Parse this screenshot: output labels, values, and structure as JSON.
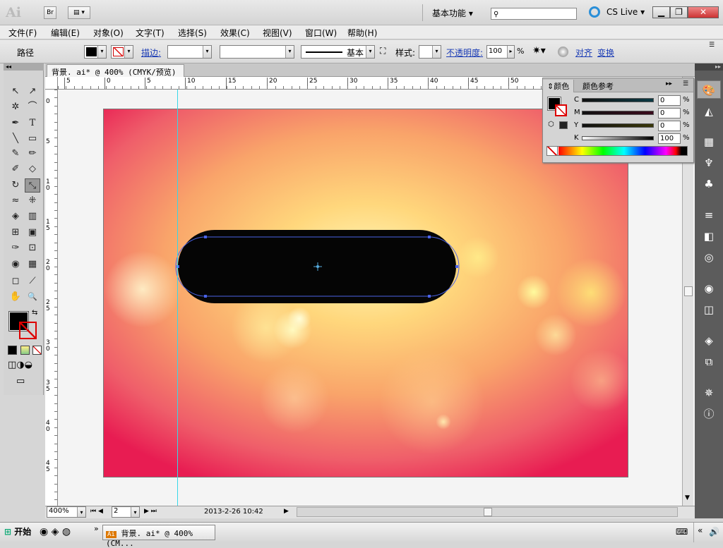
{
  "app": {
    "logo": "Ai",
    "bridge": "Br",
    "workspace": "基本功能",
    "cs_live": "CS Live",
    "window_buttons": [
      "▁",
      "❐",
      "✕"
    ]
  },
  "menu": [
    "文件(F)",
    "编辑(E)",
    "对象(O)",
    "文字(T)",
    "选择(S)",
    "效果(C)",
    "视图(V)",
    "窗口(W)",
    "帮助(H)"
  ],
  "control": {
    "selection_type": "路径",
    "stroke_label": "描边:",
    "stroke_style": "基本",
    "style_label": "样式:",
    "opacity_label": "不透明度:",
    "opacity_value": "100",
    "opacity_unit": "%",
    "align": "对齐",
    "transform": "变换"
  },
  "doc_tab": {
    "title": "背景. ai* @ 400% (CMYK/预览)",
    "close": "✕"
  },
  "ruler": {
    "h_ticks": [
      "5",
      "0",
      "5",
      "10",
      "15",
      "20",
      "25",
      "30",
      "35",
      "40",
      "45",
      "50"
    ],
    "v_ticks": [
      "0",
      "5",
      "1 0",
      "1 5",
      "2 0",
      "2 5",
      "3 0",
      "3 5",
      "4 0",
      "4 5"
    ]
  },
  "status": {
    "zoom": "400%",
    "artboard_nav": "2",
    "info": "2013-2-26  10:42"
  },
  "color_panel": {
    "tab1": "颜色",
    "tab2": "颜色参考",
    "channels": [
      {
        "name": "C",
        "value": "0",
        "unit": "%"
      },
      {
        "name": "M",
        "value": "0",
        "unit": "%"
      },
      {
        "name": "Y",
        "value": "0",
        "unit": "%"
      },
      {
        "name": "K",
        "value": "100",
        "unit": "%"
      }
    ]
  },
  "tools": [
    "↖",
    "↗",
    "✲",
    "⌒",
    "✒",
    "T",
    "╲",
    "▭",
    "✎",
    "✏",
    "✐",
    "◇",
    "↻",
    "⤡",
    "≈",
    "⁜",
    "◈",
    "▥",
    "⊞",
    "▣",
    "✑",
    "⊡",
    "◉",
    "▦",
    "◻",
    "⟋",
    "✋",
    "🔍"
  ],
  "taskbar": {
    "start": "开始",
    "window": "背景. ai* @ 400% (CM..."
  },
  "colors": {
    "accent": "#1a3bb5",
    "guide": "#37d7e8",
    "selection": "#4a63e8"
  }
}
